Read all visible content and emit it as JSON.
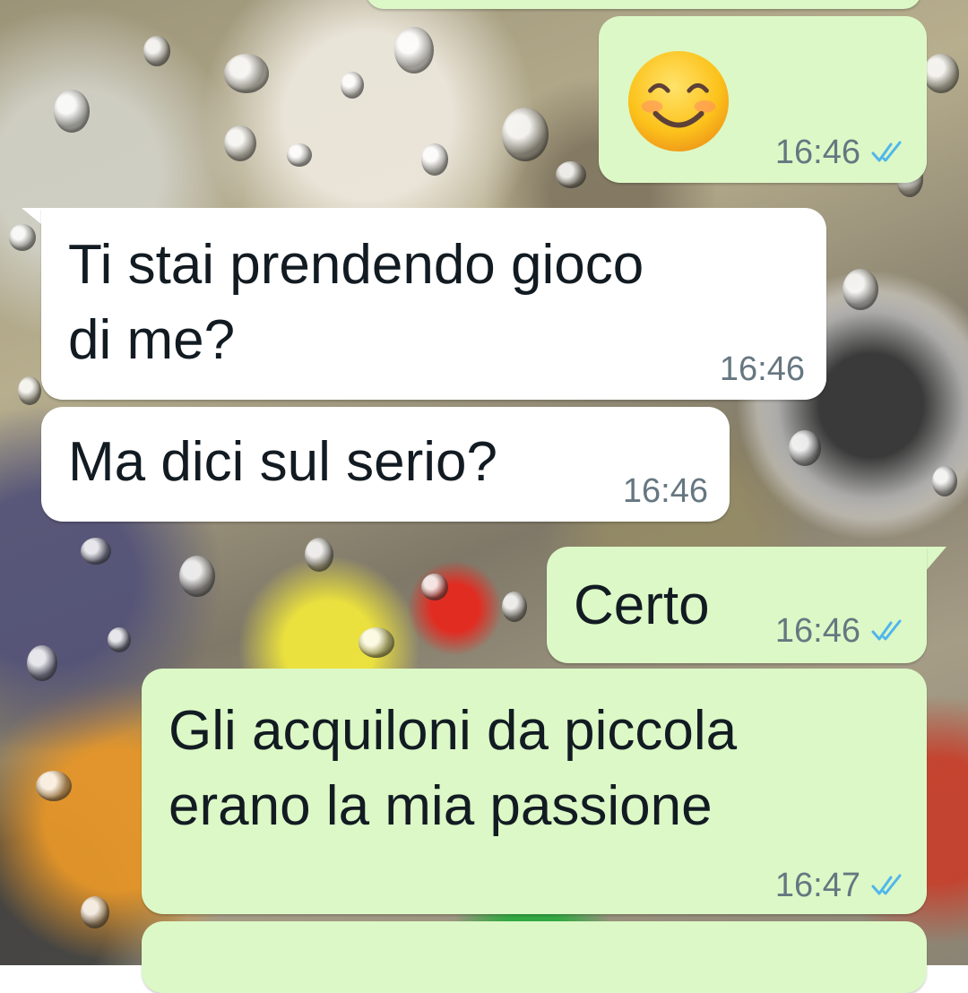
{
  "messages": [
    {
      "direction": "outgoing",
      "content": "smiling-face-with-smiling-eyes-emoji",
      "time": "16:46",
      "status": "read"
    },
    {
      "direction": "incoming",
      "line1": "Ti stai prendendo gioco",
      "line2": "di me?",
      "time": "16:46"
    },
    {
      "direction": "incoming",
      "text": "Ma dici sul serio?",
      "time": "16:46"
    },
    {
      "direction": "outgoing",
      "text": "Certo",
      "time": "16:46",
      "status": "read"
    },
    {
      "direction": "outgoing",
      "line1": "Gli acquiloni da piccola",
      "line2": "erano la mia passione",
      "time": "16:47",
      "status": "read"
    }
  ],
  "colors": {
    "outgoing_bubble": "#dcf8c6",
    "incoming_bubble": "#ffffff",
    "read_ticks": "#4fb6ec",
    "timestamp": "#667781"
  }
}
